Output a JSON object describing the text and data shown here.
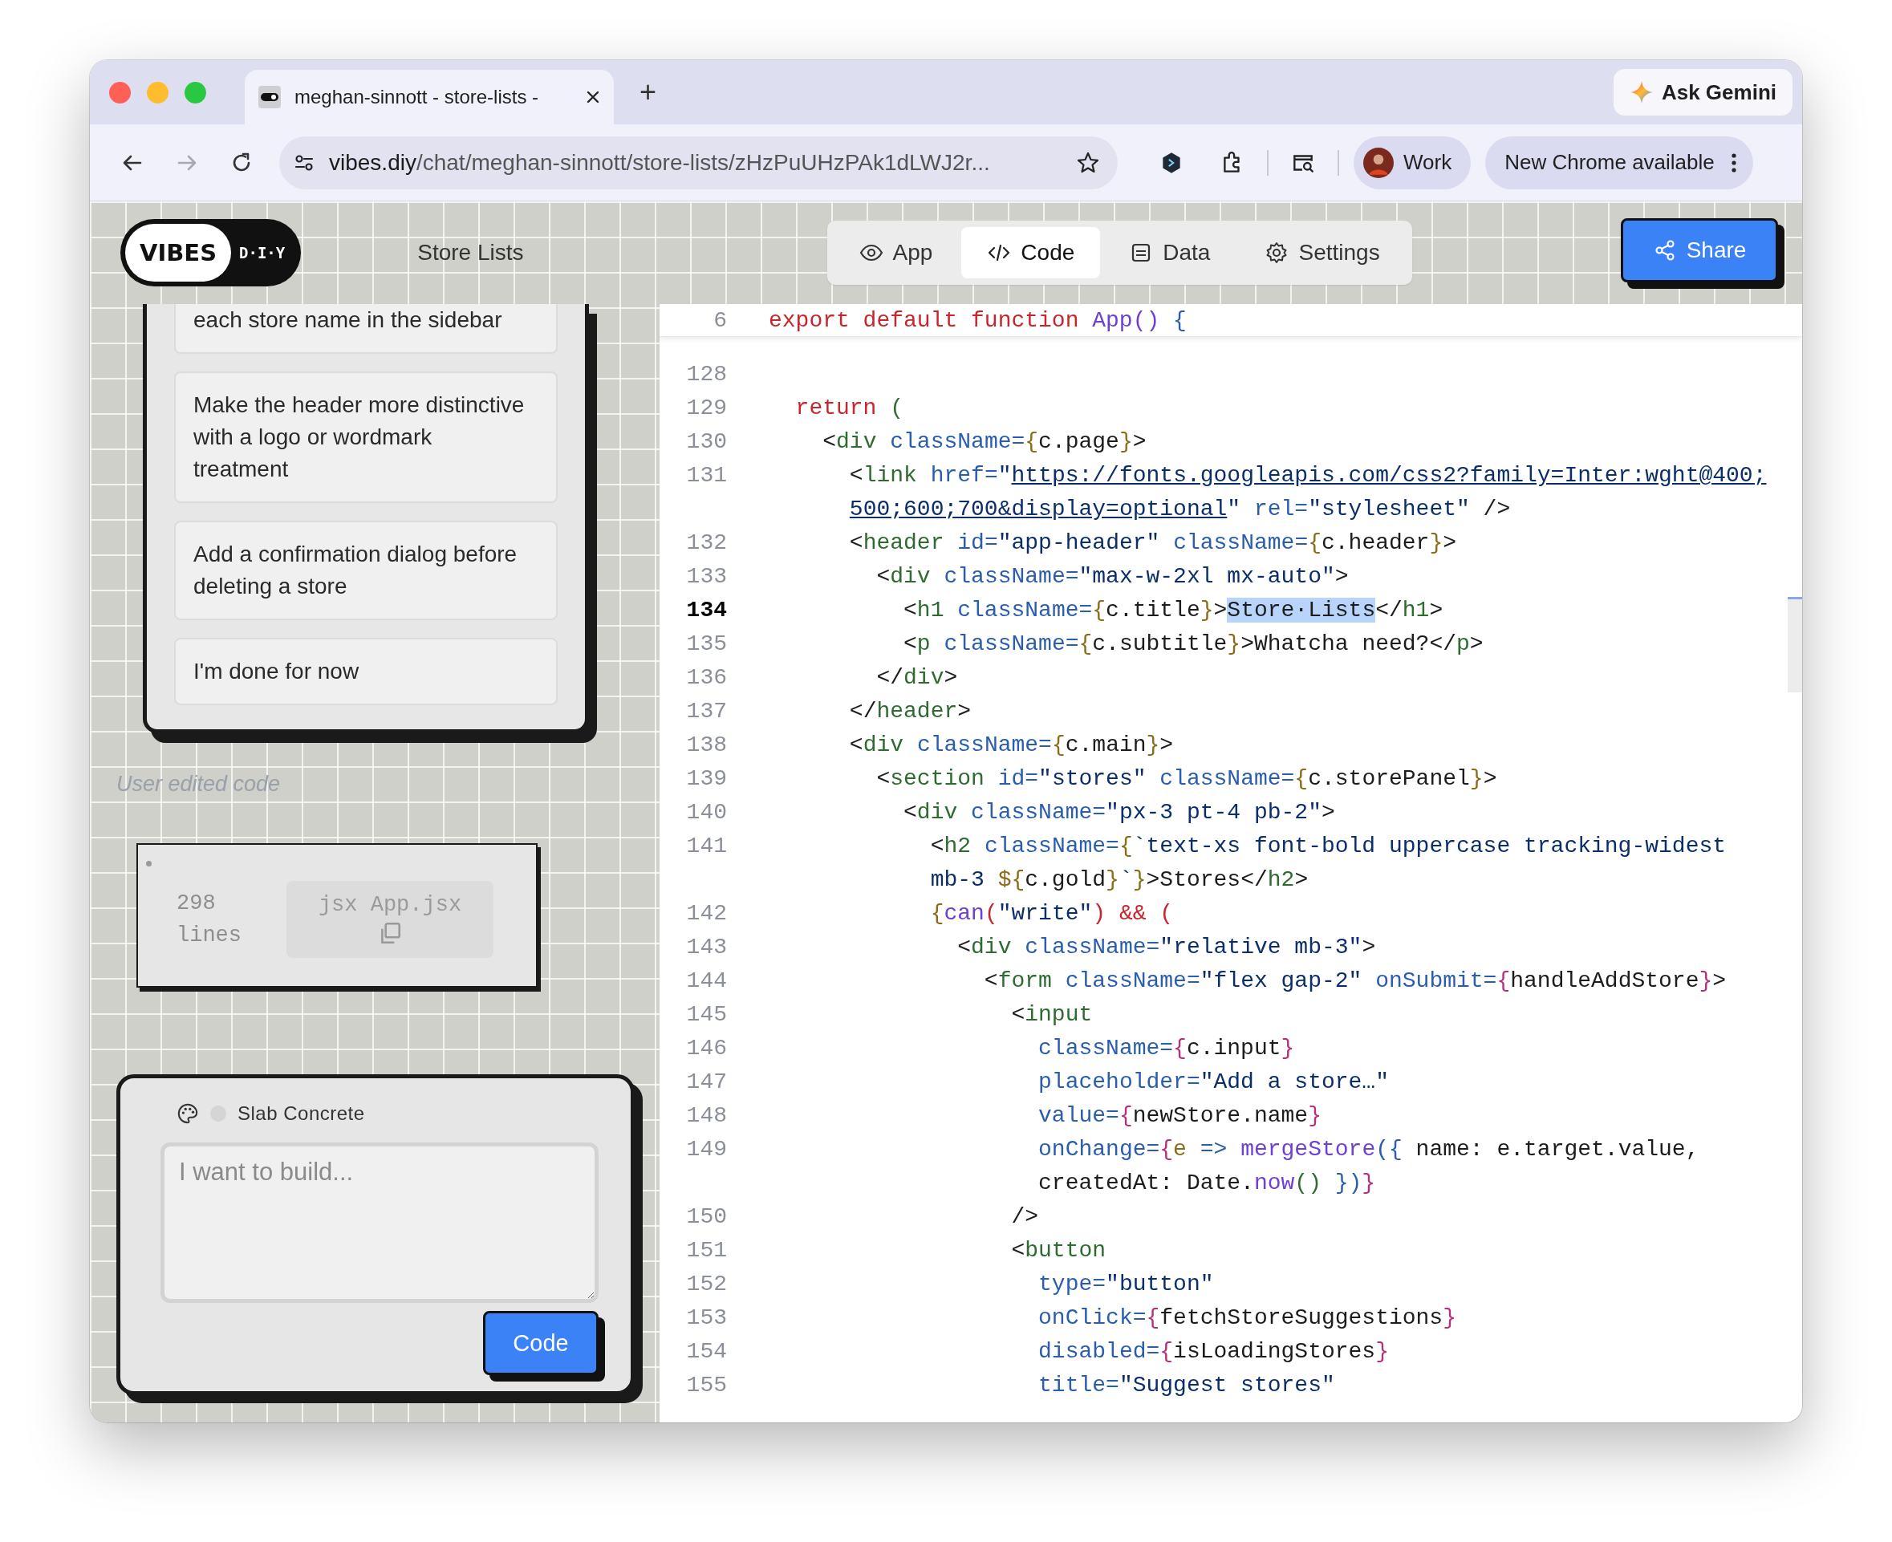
{
  "browser": {
    "tab": {
      "title": "meghan-sinnott - store-lists -"
    },
    "new_tab": "+",
    "ask_gemini": "Ask Gemini",
    "nav_buttons": [
      {
        "disabled": false
      },
      {
        "disabled": true
      },
      {
        "disabled": false
      }
    ],
    "url": {
      "domain": "vibes.diy",
      "path": "/chat/meghan-sinnott/store-lists/zHzPuUHzPAk1dLWJ2r..."
    },
    "profile": "Work",
    "update_chip": "New Chrome available"
  },
  "app": {
    "logo": {
      "word": "VIBES",
      "tag": "D·I·Y"
    },
    "title": "Store Lists",
    "view_tabs": [
      {
        "label": "App",
        "selected": false
      },
      {
        "label": "Code",
        "selected": true
      },
      {
        "label": "Data",
        "selected": false
      },
      {
        "label": "Settings",
        "selected": false
      }
    ],
    "share": "Share"
  },
  "suggestions": [
    "each store name in the sidebar",
    "Make the header more distinctive with a logo or wordmark treatment",
    "Add a confirmation dialog before deleting a store",
    "I'm done for now"
  ],
  "note": "User edited code",
  "code_file": {
    "line_count": "298",
    "line_unit": "lines",
    "language": "jsx",
    "filename": "App.jsx"
  },
  "composer": {
    "theme": "Slab Concrete",
    "placeholder": "I want to build...",
    "button": "Code"
  },
  "editor": {
    "sticky": {
      "number": "6",
      "current": false,
      "tokens": [
        {
          "kind": "keyword",
          "text": "export default function "
        },
        {
          "kind": "name",
          "text": "App()"
        },
        {
          "kind": "attr",
          "text": " {"
        }
      ]
    },
    "lines": [
      {
        "number": "128",
        "current": false
      },
      {
        "number": "129",
        "current": false,
        "tokens": [
          {
            "kind": "keyword",
            "text": "  return"
          },
          {
            "kind": "tag",
            "text": " ("
          }
        ]
      },
      {
        "number": "130",
        "current": false,
        "tokens": [
          {
            "kind": "text",
            "text": "    <"
          },
          {
            "kind": "tag",
            "text": "div"
          },
          {
            "kind": "attr",
            "text": " className="
          },
          {
            "kind": "brace",
            "text": "{"
          },
          {
            "kind": "text",
            "text": "c.page"
          },
          {
            "kind": "brace",
            "text": "}"
          },
          {
            "kind": "text",
            "text": ">"
          }
        ]
      },
      {
        "number": "131",
        "current": false,
        "tokens": [
          {
            "kind": "text",
            "text": "      <"
          },
          {
            "kind": "tag",
            "text": "link"
          },
          {
            "kind": "attr",
            "text": " href="
          },
          {
            "kind": "string",
            "text": "\""
          },
          {
            "kind": "link",
            "text": "https://fonts.googleapis.com/css2?family=Inter:wght@400;"
          }
        ]
      },
      {
        "tokens": [
          {
            "kind": "link",
            "text": "      500;600;700&display=optional"
          },
          {
            "kind": "string",
            "text": "\""
          },
          {
            "kind": "attr",
            "text": " rel="
          },
          {
            "kind": "string",
            "text": "\"stylesheet\""
          },
          {
            "kind": "text",
            "text": " />"
          }
        ]
      },
      {
        "number": "132",
        "current": false,
        "tokens": [
          {
            "kind": "text",
            "text": "      <"
          },
          {
            "kind": "tag",
            "text": "header"
          },
          {
            "kind": "attr",
            "text": " id="
          },
          {
            "kind": "string",
            "text": "\"app-header\""
          },
          {
            "kind": "attr",
            "text": " className="
          },
          {
            "kind": "brace",
            "text": "{"
          },
          {
            "kind": "text",
            "text": "c.header"
          },
          {
            "kind": "brace",
            "text": "}"
          },
          {
            "kind": "text",
            "text": ">"
          }
        ]
      },
      {
        "number": "133",
        "current": false,
        "tokens": [
          {
            "kind": "text",
            "text": "        <"
          },
          {
            "kind": "tag",
            "text": "div"
          },
          {
            "kind": "attr",
            "text": " className="
          },
          {
            "kind": "string",
            "text": "\"max-w-2xl mx-auto\""
          },
          {
            "kind": "text",
            "text": ">"
          }
        ]
      },
      {
        "number": "134",
        "current": true,
        "tokens": [
          {
            "kind": "text",
            "text": "          <"
          },
          {
            "kind": "tag",
            "text": "h1"
          },
          {
            "kind": "attr",
            "text": " className="
          },
          {
            "kind": "brace",
            "text": "{"
          },
          {
            "kind": "text",
            "text": "c.title"
          },
          {
            "kind": "brace",
            "text": "}"
          },
          {
            "kind": "text",
            "text": ">"
          },
          {
            "kind": "selection",
            "text": "Store·Lists"
          },
          {
            "kind": "text",
            "text": "</"
          },
          {
            "kind": "tag",
            "text": "h1"
          },
          {
            "kind": "text",
            "text": ">"
          }
        ]
      },
      {
        "number": "135",
        "current": false,
        "tokens": [
          {
            "kind": "text",
            "text": "          <"
          },
          {
            "kind": "tag",
            "text": "p"
          },
          {
            "kind": "attr",
            "text": " className="
          },
          {
            "kind": "brace",
            "text": "{"
          },
          {
            "kind": "text",
            "text": "c.subtitle"
          },
          {
            "kind": "brace",
            "text": "}"
          },
          {
            "kind": "text",
            "text": ">Whatcha need?</"
          },
          {
            "kind": "tag",
            "text": "p"
          },
          {
            "kind": "text",
            "text": ">"
          }
        ]
      },
      {
        "number": "136",
        "current": false,
        "tokens": [
          {
            "kind": "text",
            "text": "        </"
          },
          {
            "kind": "tag",
            "text": "div"
          },
          {
            "kind": "text",
            "text": ">"
          }
        ]
      },
      {
        "number": "137",
        "current": false,
        "tokens": [
          {
            "kind": "text",
            "text": "      </"
          },
          {
            "kind": "tag",
            "text": "header"
          },
          {
            "kind": "text",
            "text": ">"
          }
        ]
      },
      {
        "number": "138",
        "current": false,
        "tokens": [
          {
            "kind": "text",
            "text": "      <"
          },
          {
            "kind": "tag",
            "text": "div"
          },
          {
            "kind": "attr",
            "text": " className="
          },
          {
            "kind": "brace",
            "text": "{"
          },
          {
            "kind": "text",
            "text": "c.main"
          },
          {
            "kind": "brace",
            "text": "}"
          },
          {
            "kind": "text",
            "text": ">"
          }
        ]
      },
      {
        "number": "139",
        "current": false,
        "tokens": [
          {
            "kind": "text",
            "text": "        <"
          },
          {
            "kind": "tag",
            "text": "section"
          },
          {
            "kind": "attr",
            "text": " id="
          },
          {
            "kind": "string",
            "text": "\"stores\""
          },
          {
            "kind": "attr",
            "text": " className="
          },
          {
            "kind": "brace",
            "text": "{"
          },
          {
            "kind": "text",
            "text": "c.storePanel"
          },
          {
            "kind": "brace",
            "text": "}"
          },
          {
            "kind": "text",
            "text": ">"
          }
        ]
      },
      {
        "number": "140",
        "current": false,
        "tokens": [
          {
            "kind": "text",
            "text": "          <"
          },
          {
            "kind": "tag",
            "text": "div"
          },
          {
            "kind": "attr",
            "text": " className="
          },
          {
            "kind": "string",
            "text": "\"px-3 pt-4 pb-2\""
          },
          {
            "kind": "text",
            "text": ">"
          }
        ]
      },
      {
        "number": "141",
        "current": false,
        "tokens": [
          {
            "kind": "text",
            "text": "            <"
          },
          {
            "kind": "tag",
            "text": "h2"
          },
          {
            "kind": "attr",
            "text": " className="
          },
          {
            "kind": "brace",
            "text": "{"
          },
          {
            "kind": "string",
            "text": "`text-xs font-bold uppercase tracking-widest"
          }
        ]
      },
      {
        "tokens": [
          {
            "kind": "string",
            "text": "            mb-3 "
          },
          {
            "kind": "brace",
            "text": "${"
          },
          {
            "kind": "text",
            "text": "c.gold"
          },
          {
            "kind": "brace",
            "text": "}"
          },
          {
            "kind": "string",
            "text": "`"
          },
          {
            "kind": "brace",
            "text": "}"
          },
          {
            "kind": "text",
            "text": ">Stores</"
          },
          {
            "kind": "tag",
            "text": "h2"
          },
          {
            "kind": "text",
            "text": ">"
          }
        ]
      },
      {
        "number": "142",
        "current": false,
        "tokens": [
          {
            "kind": "brace",
            "text": "            {"
          },
          {
            "kind": "name",
            "text": "can"
          },
          {
            "kind": "keyword",
            "text": "("
          },
          {
            "kind": "string",
            "text": "\"write\""
          },
          {
            "kind": "keyword",
            "text": ") && ("
          }
        ]
      },
      {
        "number": "143",
        "current": false,
        "tokens": [
          {
            "kind": "text",
            "text": "              <"
          },
          {
            "kind": "tag",
            "text": "div"
          },
          {
            "kind": "attr",
            "text": " className="
          },
          {
            "kind": "string",
            "text": "\"relative mb-3\""
          },
          {
            "kind": "text",
            "text": ">"
          }
        ]
      },
      {
        "number": "144",
        "current": false,
        "tokens": [
          {
            "kind": "text",
            "text": "                <"
          },
          {
            "kind": "tag",
            "text": "form"
          },
          {
            "kind": "attr",
            "text": " className="
          },
          {
            "kind": "string",
            "text": "\"flex gap-2\""
          },
          {
            "kind": "attr",
            "text": " onSubmit="
          },
          {
            "kind": "accent",
            "text": "{"
          },
          {
            "kind": "text",
            "text": "handleAddStore"
          },
          {
            "kind": "accent",
            "text": "}"
          },
          {
            "kind": "text",
            "text": ">"
          }
        ]
      },
      {
        "number": "145",
        "current": false,
        "tokens": [
          {
            "kind": "text",
            "text": "                  <"
          },
          {
            "kind": "tag",
            "text": "input"
          }
        ]
      },
      {
        "number": "146",
        "current": false,
        "tokens": [
          {
            "kind": "attr",
            "text": "                    className="
          },
          {
            "kind": "accent",
            "text": "{"
          },
          {
            "kind": "text",
            "text": "c.input"
          },
          {
            "kind": "accent",
            "text": "}"
          }
        ]
      },
      {
        "number": "147",
        "current": false,
        "tokens": [
          {
            "kind": "attr",
            "text": "                    placeholder="
          },
          {
            "kind": "string",
            "text": "\"Add a store…\""
          }
        ]
      },
      {
        "number": "148",
        "current": false,
        "tokens": [
          {
            "kind": "attr",
            "text": "                    value="
          },
          {
            "kind": "accent",
            "text": "{"
          },
          {
            "kind": "text",
            "text": "newStore.name"
          },
          {
            "kind": "accent",
            "text": "}"
          }
        ]
      },
      {
        "number": "149",
        "current": false,
        "tokens": [
          {
            "kind": "attr",
            "text": "                    onChange="
          },
          {
            "kind": "accent",
            "text": "{"
          },
          {
            "kind": "brace",
            "text": "e"
          },
          {
            "kind": "attr",
            "text": " => "
          },
          {
            "kind": "name",
            "text": "mergeStore"
          },
          {
            "kind": "attr",
            "text": "({"
          },
          {
            "kind": "text",
            "text": " name: e.target.value,"
          }
        ]
      },
      {
        "tokens": [
          {
            "kind": "text",
            "text": "                    createdAt: Date."
          },
          {
            "kind": "name",
            "text": "now"
          },
          {
            "kind": "tag",
            "text": "()"
          },
          {
            "kind": "attr",
            "text": " })"
          },
          {
            "kind": "accent",
            "text": "}"
          }
        ]
      },
      {
        "number": "150",
        "current": false,
        "tokens": [
          {
            "kind": "text",
            "text": "                  />"
          }
        ]
      },
      {
        "number": "151",
        "current": false,
        "tokens": [
          {
            "kind": "text",
            "text": "                  <"
          },
          {
            "kind": "tag",
            "text": "button"
          }
        ]
      },
      {
        "number": "152",
        "current": false,
        "tokens": [
          {
            "kind": "attr",
            "text": "                    type="
          },
          {
            "kind": "string",
            "text": "\"button\""
          }
        ]
      },
      {
        "number": "153",
        "current": false,
        "tokens": [
          {
            "kind": "attr",
            "text": "                    onClick="
          },
          {
            "kind": "accent",
            "text": "{"
          },
          {
            "kind": "text",
            "text": "fetchStoreSuggestions"
          },
          {
            "kind": "accent",
            "text": "}"
          }
        ]
      },
      {
        "number": "154",
        "current": false,
        "tokens": [
          {
            "kind": "attr",
            "text": "                    disabled="
          },
          {
            "kind": "accent",
            "text": "{"
          },
          {
            "kind": "text",
            "text": "isLoadingStores"
          },
          {
            "kind": "accent",
            "text": "}"
          }
        ]
      },
      {
        "number": "155",
        "current": false,
        "tokens": [
          {
            "kind": "attr",
            "text": "                    title="
          },
          {
            "kind": "string",
            "text": "\"Suggest stores\""
          }
        ]
      }
    ]
  }
}
